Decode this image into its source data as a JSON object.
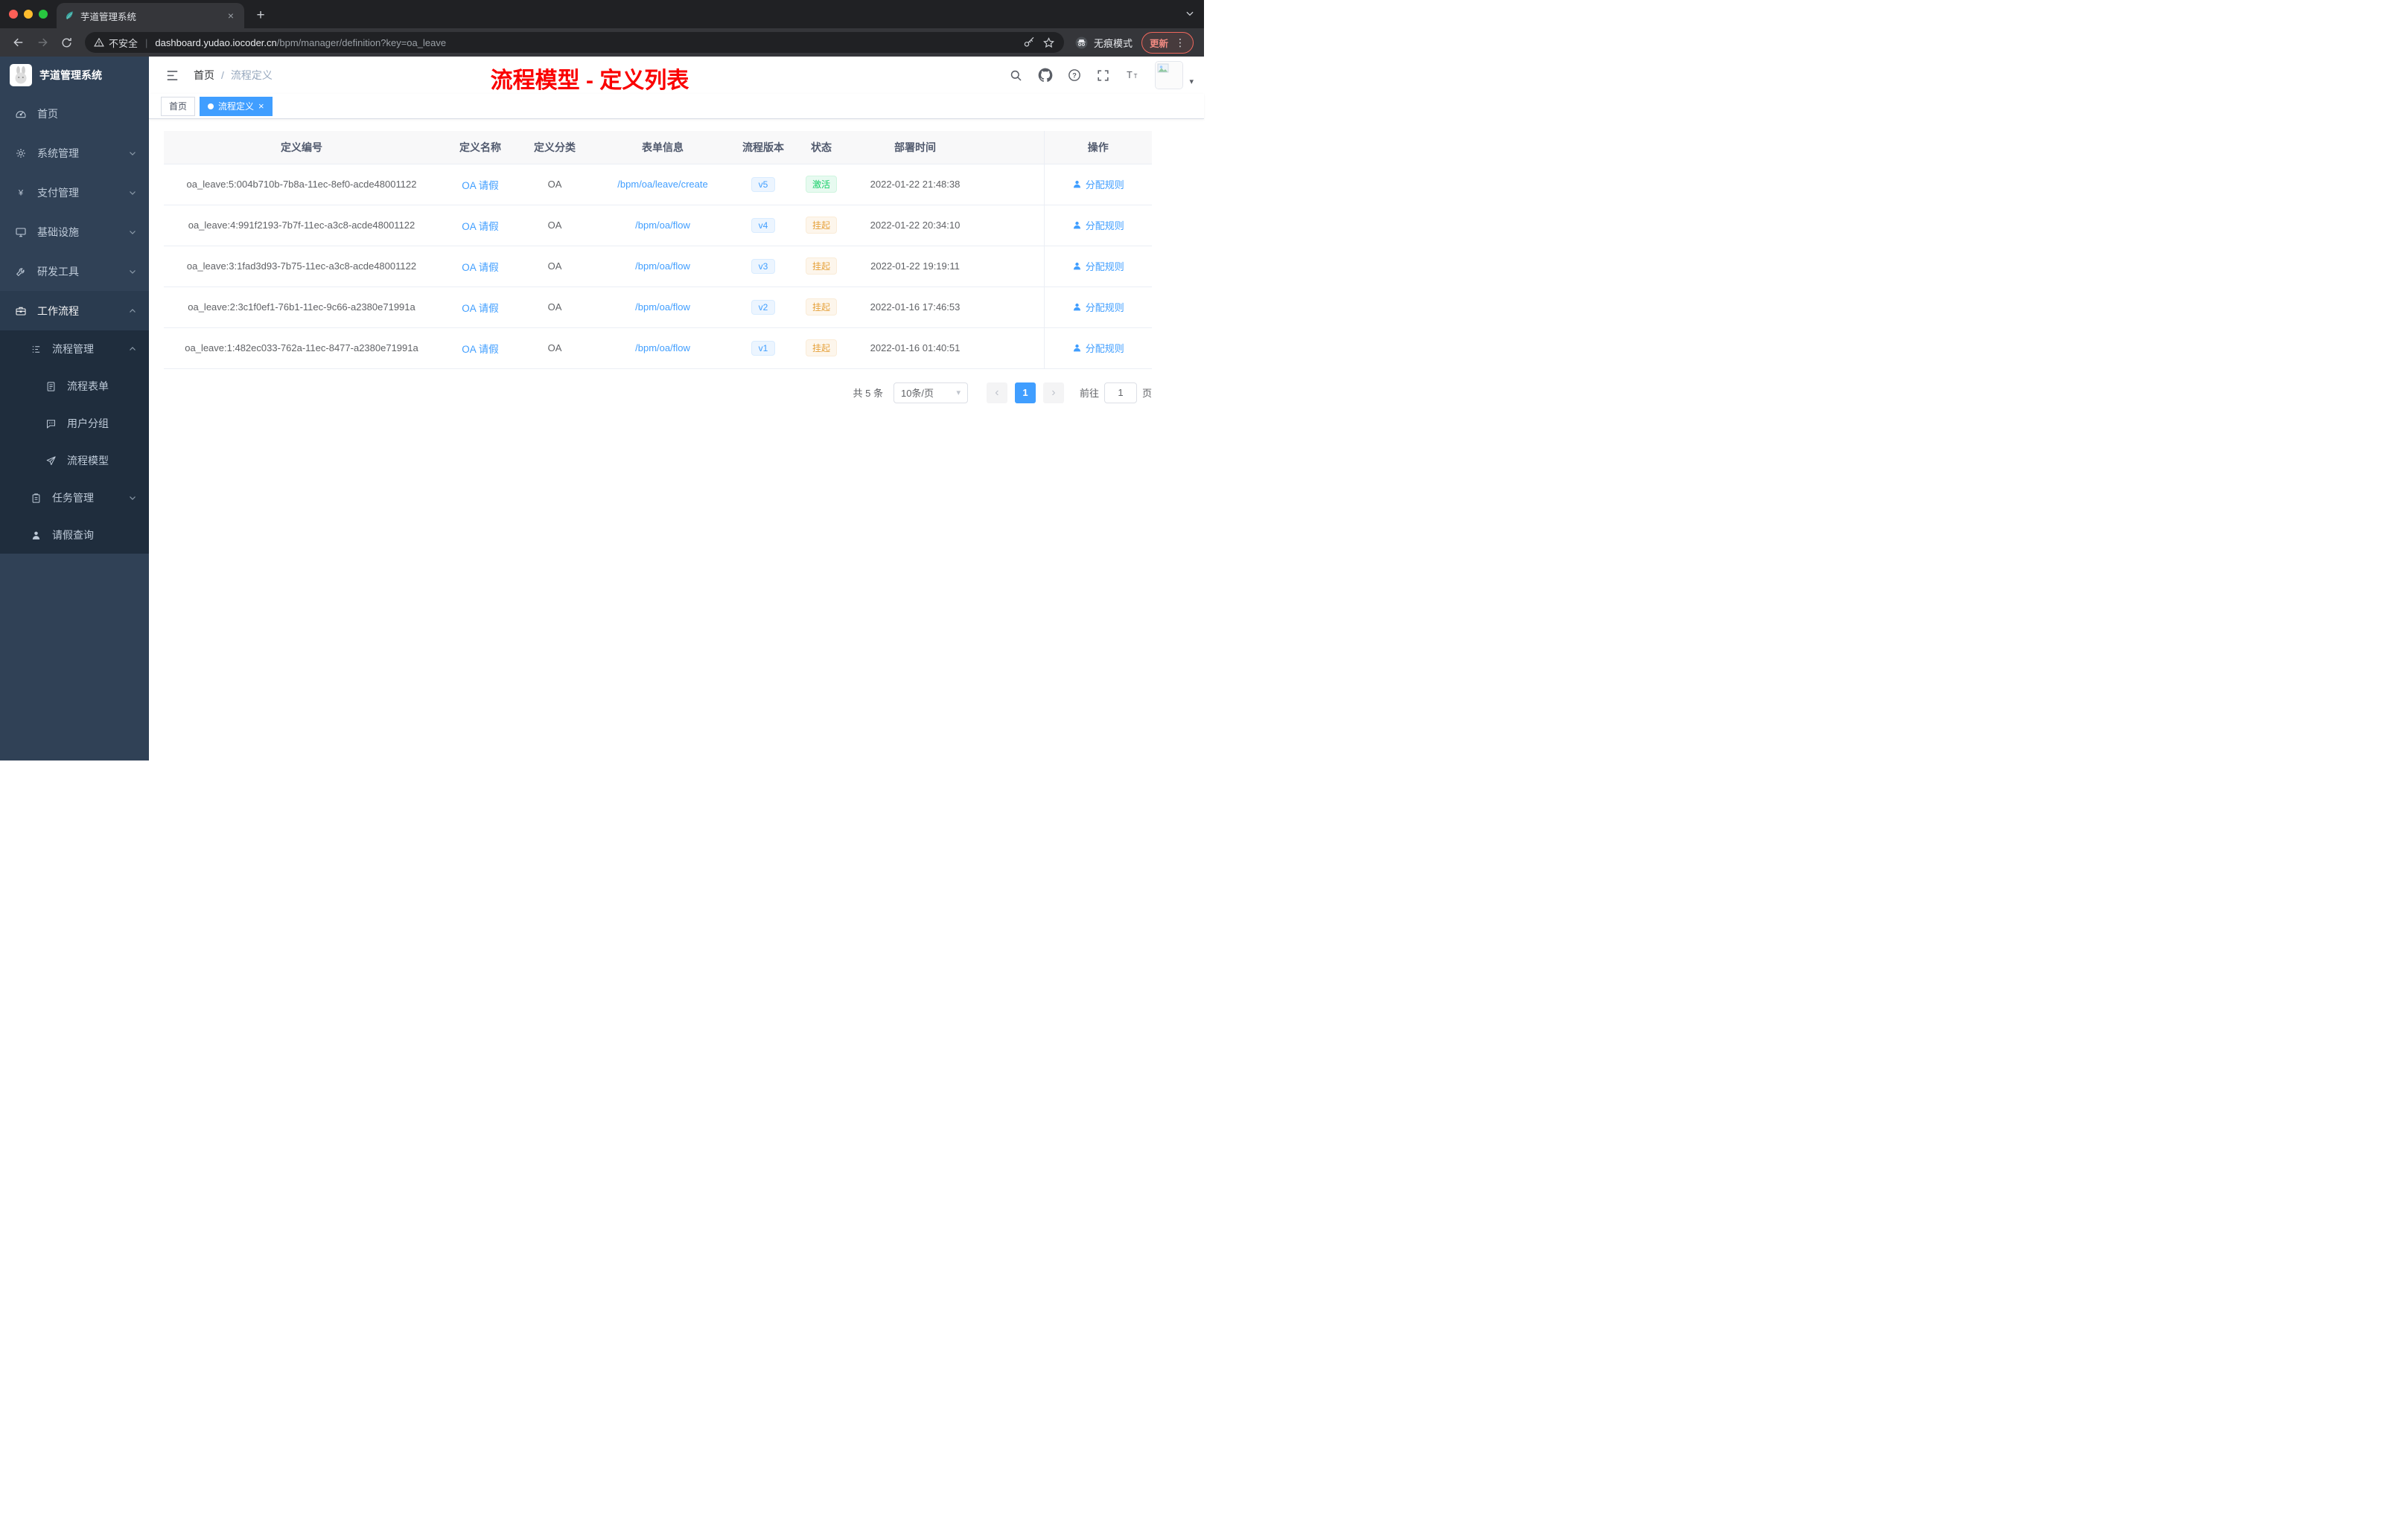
{
  "colors": {
    "accent": "#409eff",
    "success": "#13ce66",
    "warning": "#e6a23c",
    "annotation_red": "#fa0000",
    "sidebar_bg": "#304156",
    "submenu_bg": "#1f2d3d"
  },
  "glyphs": {
    "close": "×",
    "plus": "+",
    "caret_down": "▾",
    "chevron_prev": "‹",
    "chevron_next": "›",
    "more_vertical": "⋮",
    "divider": "|",
    "breadcrumb_sep": "/"
  },
  "browser": {
    "tab_title": "芋道管理系统",
    "security_label": "不安全",
    "url_host": "dashboard.yudao.iocoder.cn",
    "url_path": "/bpm/manager/definition?key=oa_leave",
    "incognito_label": "无痕模式",
    "update_label": "更新"
  },
  "sidebar": {
    "logo_title": "芋道管理系统",
    "items": [
      {
        "label": "首页"
      },
      {
        "label": "系统管理"
      },
      {
        "label": "支付管理"
      },
      {
        "label": "基础设施"
      },
      {
        "label": "研发工具"
      },
      {
        "label": "工作流程"
      }
    ],
    "sub": {
      "process_manage": "流程管理",
      "process_form": "流程表单",
      "user_group": "用户分组",
      "process_model": "流程模型",
      "task_manage": "任务管理",
      "leave_query": "请假查询"
    }
  },
  "header": {
    "breadcrumb_home": "首页",
    "breadcrumb_current": "流程定义",
    "annotation": "流程模型 - 定义列表"
  },
  "tags": {
    "home": "首页",
    "active": "流程定义"
  },
  "table": {
    "columns": [
      "定义编号",
      "定义名称",
      "定义分类",
      "表单信息",
      "流程版本",
      "状态",
      "部署时间",
      "操作"
    ],
    "rows": [
      {
        "id": "oa_leave:5:004b710b-7b8a-11ec-8ef0-acde48001122",
        "name": "OA 请假",
        "category": "OA",
        "form": "/bpm/oa/leave/create",
        "version": "v5",
        "status": "激活",
        "time": "2022-01-22 21:48:38",
        "action": "分配规则"
      },
      {
        "id": "oa_leave:4:991f2193-7b7f-11ec-a3c8-acde48001122",
        "name": "OA 请假",
        "category": "OA",
        "form": "/bpm/oa/flow",
        "version": "v4",
        "status": "挂起",
        "time": "2022-01-22 20:34:10",
        "action": "分配规则"
      },
      {
        "id": "oa_leave:3:1fad3d93-7b75-11ec-a3c8-acde48001122",
        "name": "OA 请假",
        "category": "OA",
        "form": "/bpm/oa/flow",
        "version": "v3",
        "status": "挂起",
        "time": "2022-01-22 19:19:11",
        "action": "分配规则"
      },
      {
        "id": "oa_leave:2:3c1f0ef1-76b1-11ec-9c66-a2380e71991a",
        "name": "OA 请假",
        "category": "OA",
        "form": "/bpm/oa/flow",
        "version": "v2",
        "status": "挂起",
        "time": "2022-01-16 17:46:53",
        "action": "分配规则"
      },
      {
        "id": "oa_leave:1:482ec033-762a-11ec-8477-a2380e71991a",
        "name": "OA 请假",
        "category": "OA",
        "form": "/bpm/oa/flow",
        "version": "v1",
        "status": "挂起",
        "time": "2022-01-16 01:40:51",
        "action": "分配规则"
      }
    ]
  },
  "pagination": {
    "total": "共 5 条",
    "page_size": "10条/页",
    "page": "1",
    "goto": "前往",
    "goto_value": "1",
    "unit": "页"
  }
}
